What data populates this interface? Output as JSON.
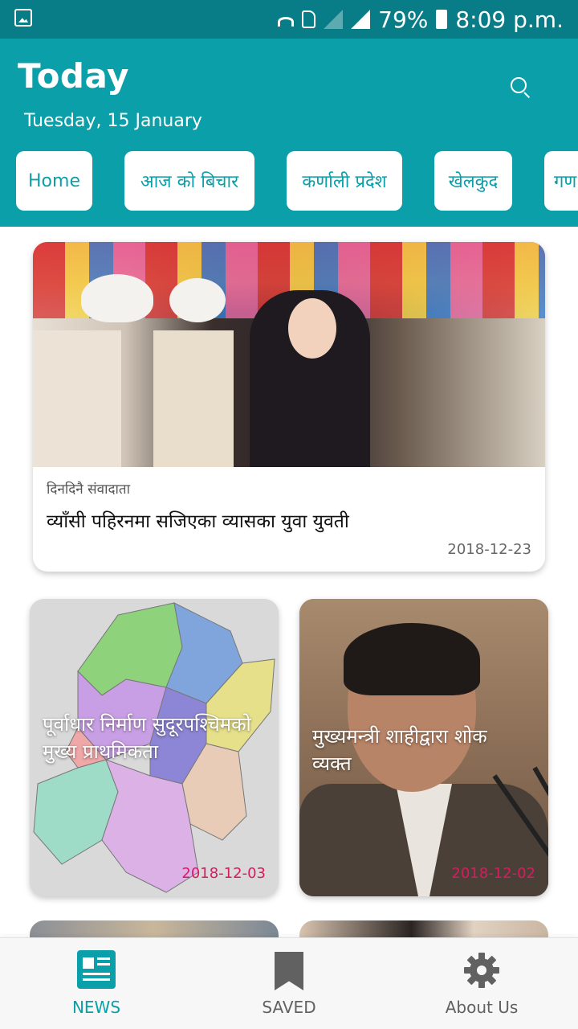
{
  "status_bar": {
    "battery": "79%",
    "time": "8:09 p.m."
  },
  "header": {
    "title": "Today",
    "date": "Tuesday, 15 January"
  },
  "tabs": [
    {
      "label": "Home"
    },
    {
      "label": "आज को बिचार"
    },
    {
      "label": "कर्णाली प्रदेश"
    },
    {
      "label": "खेलकुद"
    },
    {
      "label": "गण"
    }
  ],
  "featured": {
    "byline": "दिनदिनै संवादाता",
    "headline": "व्याँसी पहिरनमा सजिएका व्यासका युवा युवती",
    "date": "2018-12-23"
  },
  "grid": [
    {
      "title": "पूर्वाधार निर्माण सुदूरपश्चिमको मुख्य प्राथमिकता",
      "date": "2018-12-03"
    },
    {
      "title": "मुख्यमन्त्री शाहीद्वारा शोक व्यक्त",
      "date": "2018-12-02"
    }
  ],
  "bottom_nav": {
    "news": "NEWS",
    "saved": "SAVED",
    "about": "About Us"
  },
  "colors": {
    "status_bar": "#087d87",
    "primary": "#0b9fa9",
    "date_accent": "#d81b60"
  }
}
